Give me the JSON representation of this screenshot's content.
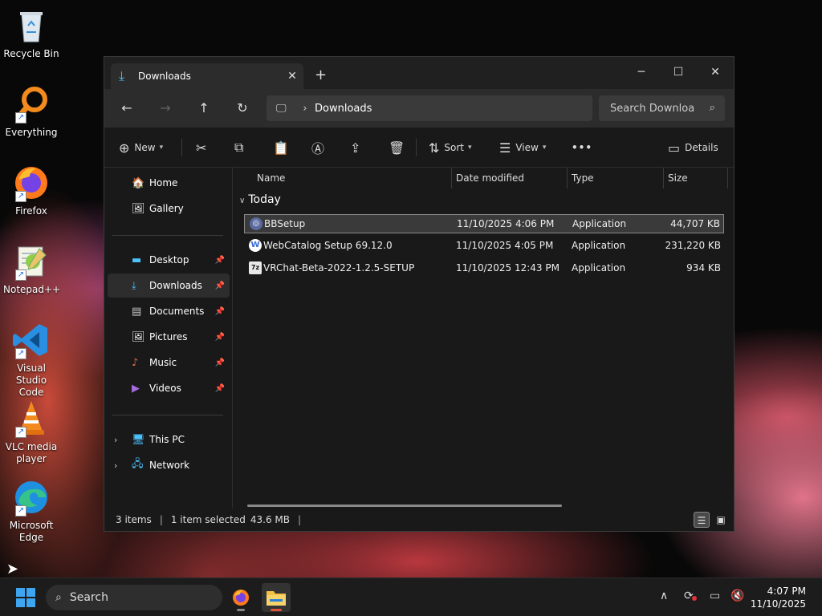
{
  "desktop": {
    "icons": [
      {
        "label": "Recycle Bin",
        "icon": "recycle-bin-icon"
      },
      {
        "label": "Everything",
        "icon": "everything-search-icon"
      },
      {
        "label": "Firefox",
        "icon": "firefox-icon"
      },
      {
        "label": "Notepad++",
        "icon": "notepad-plus-plus-icon"
      },
      {
        "label": "Visual Studio Code",
        "icon": "vscode-icon"
      },
      {
        "label": "VLC media player",
        "icon": "vlc-icon"
      },
      {
        "label": "Microsoft Edge",
        "icon": "edge-icon"
      }
    ]
  },
  "window": {
    "tab_title": "Downloads",
    "new_tab_glyph": "+",
    "controls": {
      "minimize": "─",
      "maximize": "☐",
      "close": "✕"
    },
    "address": {
      "crumb": "Downloads",
      "separator": "›"
    },
    "search_placeholder": "Search Downloa",
    "toolbar": {
      "new_label": "New",
      "sort_label": "Sort",
      "view_label": "View",
      "more_label": "•••",
      "details_label": "Details"
    },
    "sidebar": {
      "home": "Home",
      "gallery": "Gallery",
      "desktop": "Desktop",
      "downloads": "Downloads",
      "documents": "Documents",
      "pictures": "Pictures",
      "music": "Music",
      "videos": "Videos",
      "this_pc": "This PC",
      "network": "Network"
    },
    "columns": {
      "name": "Name",
      "date": "Date modified",
      "type": "Type",
      "size": "Size"
    },
    "group_label": "Today",
    "files": [
      {
        "name": "BBSetup",
        "date": "11/10/2025 4:06 PM",
        "type": "Application",
        "size": "44,707 KB",
        "icon": "bbsetup-app-icon"
      },
      {
        "name": "WebCatalog Setup 69.12.0",
        "date": "11/10/2025 4:05 PM",
        "type": "Application",
        "size": "231,220 KB",
        "icon": "webcatalog-app-icon"
      },
      {
        "name": "VRChat-Beta-2022-1.2.5-SETUP",
        "date": "11/10/2025 12:43 PM",
        "type": "Application",
        "size": "934 KB",
        "icon": "vrchat-setup-icon"
      }
    ],
    "status": {
      "count": "3 items",
      "selection": "1 item selected",
      "size": "43.6 MB"
    }
  },
  "taskbar": {
    "search_label": "Search",
    "time": "4:07 PM",
    "date": "11/10/2025"
  },
  "colors": {
    "accent": "#4cc2ff",
    "window_bg": "#191919",
    "taskbar_bg": "#1c1c1c"
  }
}
